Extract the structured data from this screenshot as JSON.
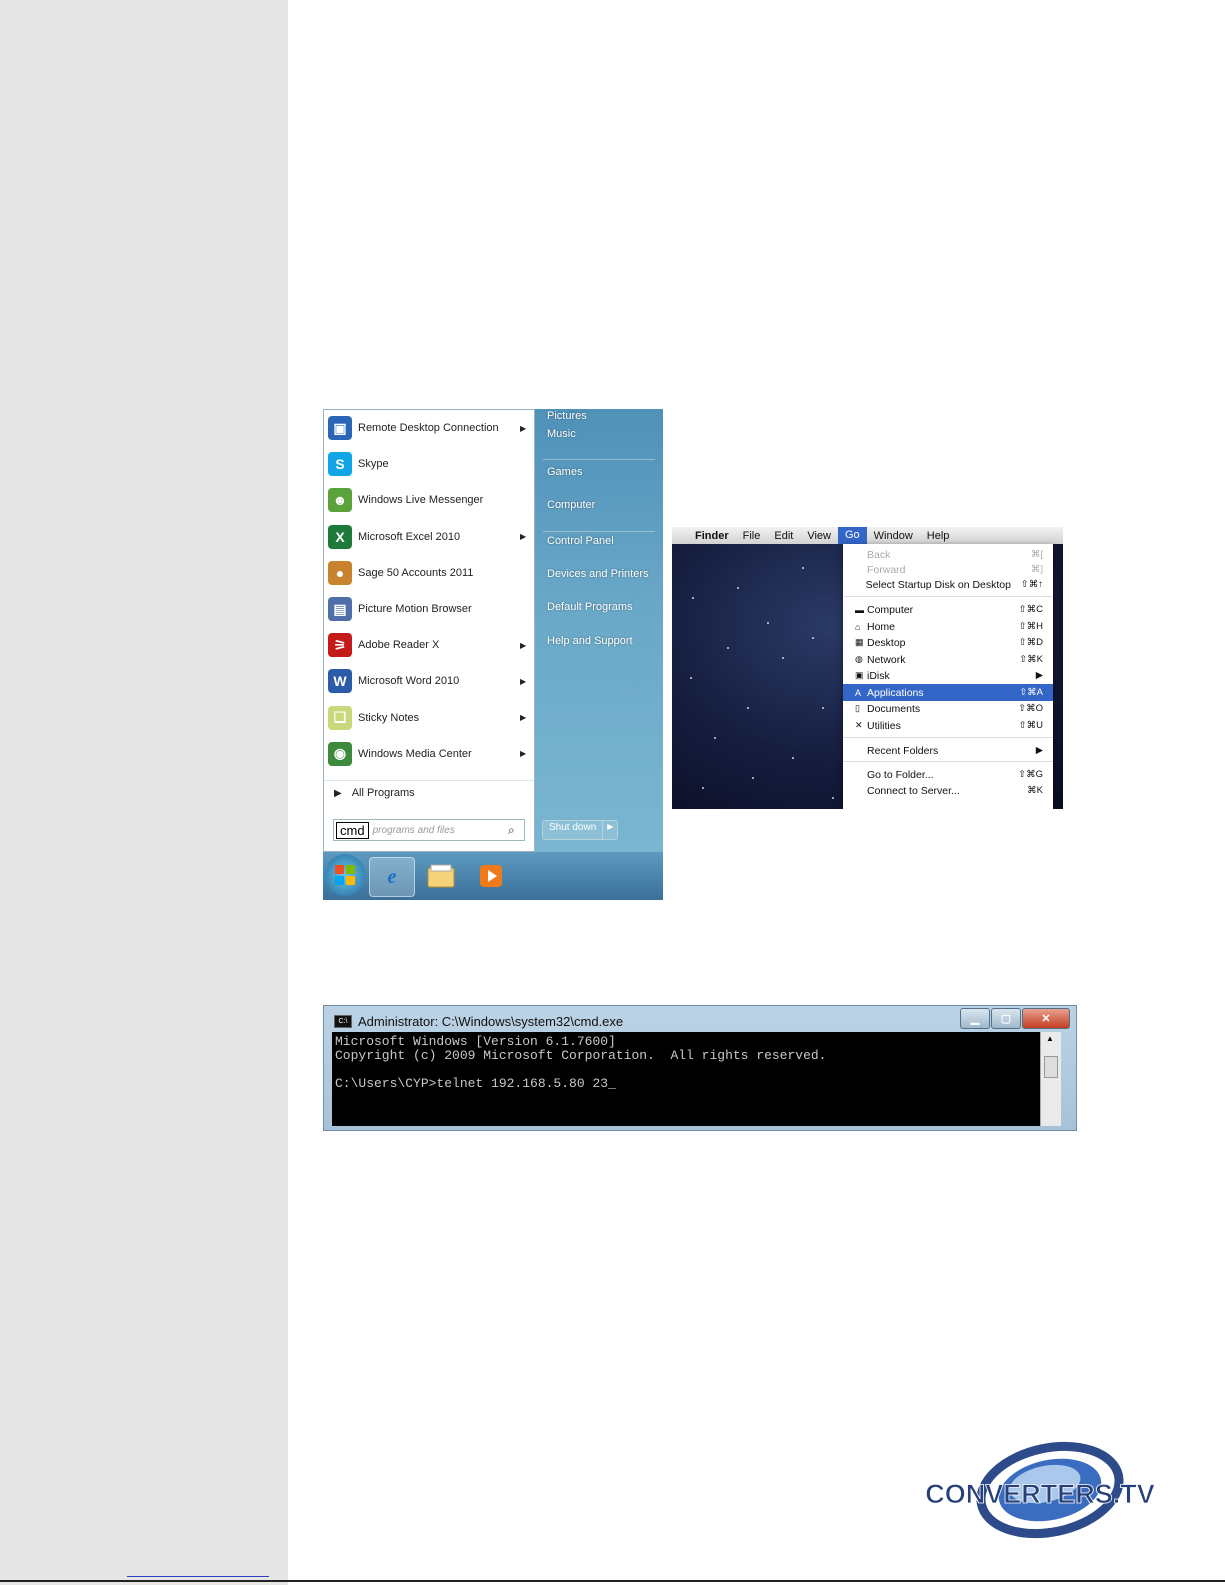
{
  "win7": {
    "programs": [
      {
        "label": "Remote Desktop Connection",
        "icon": "remote-desktop-icon",
        "arrow": true
      },
      {
        "label": "Skype",
        "icon": "skype-icon",
        "arrow": false
      },
      {
        "label": "Windows Live Messenger",
        "icon": "messenger-icon",
        "arrow": false
      },
      {
        "label": "Microsoft Excel 2010",
        "icon": "excel-icon",
        "arrow": true
      },
      {
        "label": "Sage 50 Accounts 2011",
        "icon": "sage-icon",
        "arrow": false
      },
      {
        "label": "Picture Motion Browser",
        "icon": "picture-browser-icon",
        "arrow": false
      },
      {
        "label": "Adobe Reader X",
        "icon": "adobe-reader-icon",
        "arrow": true
      },
      {
        "label": "Microsoft Word 2010",
        "icon": "word-icon",
        "arrow": true
      },
      {
        "label": "Sticky Notes",
        "icon": "sticky-notes-icon",
        "arrow": true
      },
      {
        "label": "Windows Media Center",
        "icon": "media-center-icon",
        "arrow": true
      }
    ],
    "all_programs": "All Programs",
    "search_value": "cmd",
    "search_placeholder": "programs and files",
    "right_links": [
      "Pictures",
      "Music",
      "Games",
      "Computer",
      "Control Panel",
      "Devices and Printers",
      "Default Programs",
      "Help and Support"
    ],
    "shutdown_label": "Shut down"
  },
  "mac": {
    "menubar": [
      "Finder",
      "File",
      "Edit",
      "View",
      "Go",
      "Window",
      "Help"
    ],
    "go_menu": [
      {
        "label": "Back",
        "shortcut": "⌘[",
        "disabled": true
      },
      {
        "label": "Forward",
        "shortcut": "⌘]",
        "disabled": true
      },
      {
        "label": "Select Startup Disk on Desktop",
        "shortcut": "⇧⌘↑"
      },
      {
        "label": "Computer",
        "shortcut": "⇧⌘C",
        "icon": "computer-icon"
      },
      {
        "label": "Home",
        "shortcut": "⇧⌘H",
        "icon": "home-icon"
      },
      {
        "label": "Desktop",
        "shortcut": "⇧⌘D",
        "icon": "desktop-icon"
      },
      {
        "label": "Network",
        "shortcut": "⇧⌘K",
        "icon": "network-icon"
      },
      {
        "label": "iDisk",
        "shortcut": "▶",
        "icon": "idisk-icon"
      },
      {
        "label": "Applications",
        "shortcut": "⇧⌘A",
        "icon": "applications-icon",
        "selected": true
      },
      {
        "label": "Documents",
        "shortcut": "⇧⌘O",
        "icon": "documents-icon"
      },
      {
        "label": "Utilities",
        "shortcut": "⇧⌘U",
        "icon": "utilities-icon"
      },
      {
        "label": "Recent Folders",
        "shortcut": "▶"
      },
      {
        "label": "Go to Folder...",
        "shortcut": "⇧⌘G"
      },
      {
        "label": "Connect to Server...",
        "shortcut": "⌘K"
      }
    ]
  },
  "cmd": {
    "title": "Administrator: C:\\Windows\\system32\\cmd.exe",
    "lines": [
      "Microsoft Windows [Version 6.1.7600]",
      "Copyright (c) 2009 Microsoft Corporation.  All rights reserved.",
      "",
      "C:\\Users\\CYP>telnet 192.168.5.80 23_"
    ]
  },
  "logo": {
    "text": "CONVERTERS.TV"
  }
}
